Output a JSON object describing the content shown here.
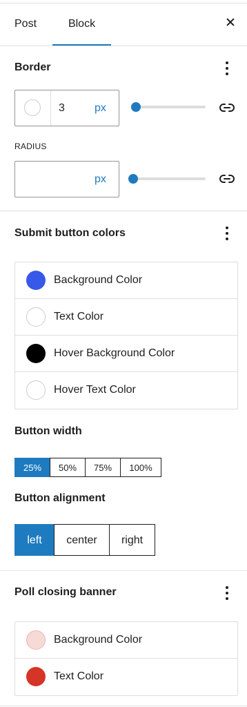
{
  "tabs": {
    "post": "Post",
    "block": "Block"
  },
  "border": {
    "title": "Border",
    "width_value": "3",
    "width_unit": "px",
    "radius_label": "RADIUS",
    "radius_value": "",
    "radius_unit": "px"
  },
  "submit_colors": {
    "title": "Submit button colors",
    "items": [
      {
        "label": "Background Color",
        "color": "#3858e9"
      },
      {
        "label": "Text Color",
        "color": "#ffffff"
      },
      {
        "label": "Hover Background Color",
        "color": "#000000"
      },
      {
        "label": "Hover Text Color",
        "color": "#ffffff"
      }
    ]
  },
  "button_width": {
    "title": "Button width",
    "options": [
      "25%",
      "50%",
      "75%",
      "100%"
    ],
    "selected": "25%"
  },
  "button_alignment": {
    "title": "Button alignment",
    "options": [
      "left",
      "center",
      "right"
    ],
    "selected": "left"
  },
  "closing_banner": {
    "title": "Poll closing banner",
    "items": [
      {
        "label": "Background Color",
        "color": "#f7d9d5"
      },
      {
        "label": "Text Color",
        "color": "#d63427"
      }
    ]
  },
  "accent_color": "#1e7bbf",
  "icons": [
    "close-icon",
    "kebab-icon",
    "link-icon"
  ]
}
